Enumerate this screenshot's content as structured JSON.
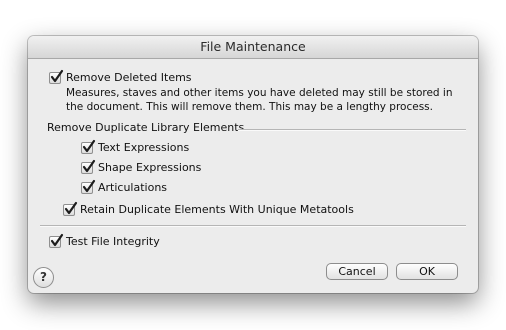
{
  "dialog": {
    "title": "File Maintenance",
    "remove_deleted": {
      "label": "Remove Deleted Items",
      "checked": true,
      "description_line1": "Measures, staves and other items you have deleted may still be stored in",
      "description_line2": "the document. This will remove them. This may be a lengthy process."
    },
    "duplicates_section": {
      "heading": "Remove Duplicate Library Elements",
      "items": [
        {
          "label": "Text Expressions",
          "checked": true
        },
        {
          "label": "Shape Expressions",
          "checked": true
        },
        {
          "label": "Articulations",
          "checked": true
        }
      ],
      "retain": {
        "label": "Retain Duplicate Elements With Unique Metatools",
        "checked": true
      }
    },
    "test_integrity": {
      "label": "Test File Integrity",
      "checked": true
    },
    "buttons": {
      "cancel": "Cancel",
      "ok": "OK",
      "help": "?"
    }
  }
}
